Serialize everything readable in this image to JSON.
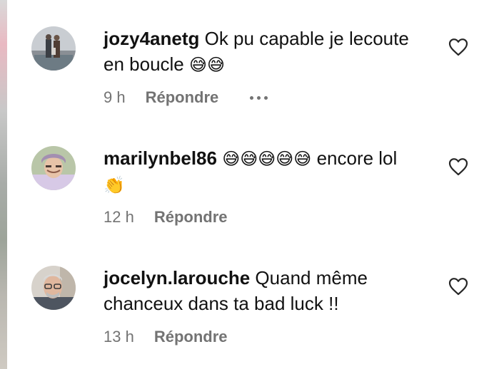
{
  "comments": [
    {
      "username": "jozy4anetg",
      "text": "Ok pu capable je lecoute en boucle",
      "emoji": "😅😅",
      "time": "9 h",
      "reply_label": "Répondre",
      "has_more_menu": true
    },
    {
      "username": "marilynbel86",
      "emoji_before": "😅😅😅😅😅",
      "text": "encore lol",
      "emoji": "👏",
      "time": "12 h",
      "reply_label": "Répondre"
    },
    {
      "username": "jocelyn.larouche",
      "text": "Quand même chanceux dans ta bad luck !!",
      "time": "13 h",
      "reply_label": "Répondre"
    }
  ],
  "icons": {
    "like": "heart-outline-icon",
    "more": "more-options-icon"
  },
  "colors": {
    "text": "#111111",
    "secondary": "#737373",
    "background": "#ffffff"
  }
}
